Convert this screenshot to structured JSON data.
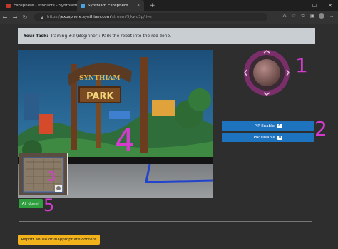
{
  "browser": {
    "tabs": [
      {
        "label": "Exosphere - Products - Synthiam"
      },
      {
        "label": "Synthiam Exosphere"
      }
    ],
    "url_host": "exosphere.synthiam.com",
    "url_prefix": "https://",
    "url_path": "/stream/5jkwd3p/live"
  },
  "task": {
    "prefix": "Your Task:",
    "text": "Training #2 (Beginner): Park the robot into the red zone."
  },
  "scene": {
    "sign_top": "SYNTHIAM",
    "sign_main": "PARK"
  },
  "controls": {
    "pip_enable_label": "PiP Enable",
    "pip_enable_key": "A",
    "pip_disable_label": "PiP Disable",
    "pip_disable_key": "B",
    "all_done_label": "All done!",
    "report_label": "Report abuse or inappropriate content"
  },
  "annotations": {
    "one": "1",
    "two": "2",
    "three": "3",
    "four": "4",
    "five": "5"
  },
  "colors": {
    "annotation": "#d63bd0",
    "blue_button": "#1e73be",
    "green_button": "#2e9e3e",
    "yellow_button": "#f2b21b"
  }
}
